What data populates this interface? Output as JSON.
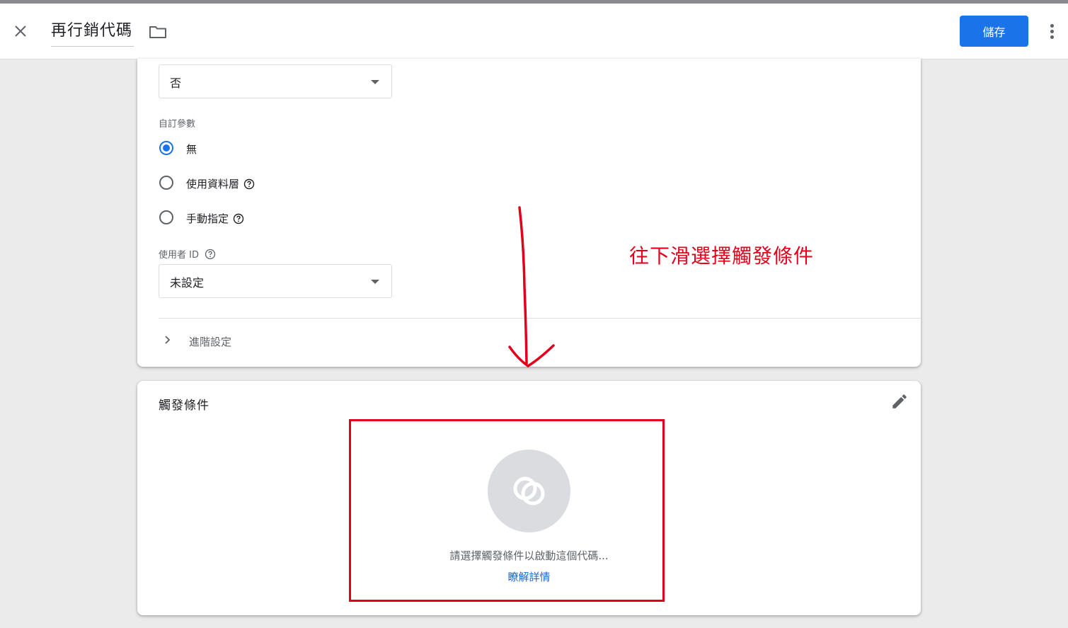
{
  "header": {
    "title": "再行銷代碼",
    "save_label": "儲存"
  },
  "config": {
    "top_select_value": "否",
    "custom_params_label": "自訂參數",
    "radios": [
      {
        "label": "無",
        "checked": true
      },
      {
        "label": "使用資料層",
        "checked": false
      },
      {
        "label": "手動指定",
        "checked": false
      }
    ],
    "user_id_label": "使用者 ID",
    "user_id_value": "未設定",
    "advanced_label": "進階設定"
  },
  "triggers": {
    "title": "觸發條件",
    "message": "請選擇觸發條件以啟動這個代碼...",
    "learn_more": "瞭解詳情"
  },
  "annotation": {
    "text": "往下滑選擇觸發條件",
    "color": "#e2001a"
  },
  "colors": {
    "accent": "#1a73e8",
    "link": "#1967d2"
  }
}
